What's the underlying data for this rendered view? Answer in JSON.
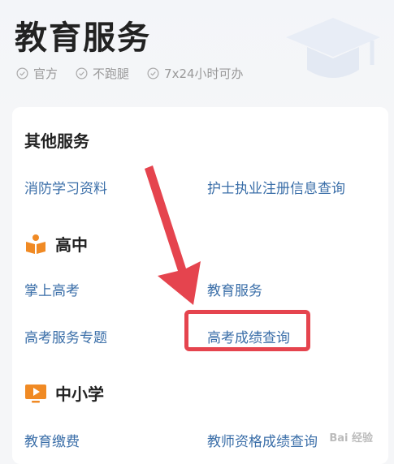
{
  "header": {
    "title": "教育服务",
    "tags": [
      "官方",
      "不跑腿",
      "7x24小时可办"
    ]
  },
  "sections": {
    "other": {
      "title": "其他服务",
      "items": [
        "消防学习资料",
        "护士执业注册信息查询"
      ]
    },
    "high_school": {
      "title": "高中",
      "items": [
        "掌上高考",
        "教育服务",
        "高考服务专题",
        "高考成绩查询"
      ]
    },
    "k12": {
      "title": "中小学",
      "items": [
        "教育缴费",
        "教师资格成绩查询"
      ]
    }
  },
  "watermark": "Bai 经验",
  "colors": {
    "accent_orange": "#f08a24",
    "link_blue": "#3a6ea8",
    "annotation_red": "#e5444e"
  }
}
